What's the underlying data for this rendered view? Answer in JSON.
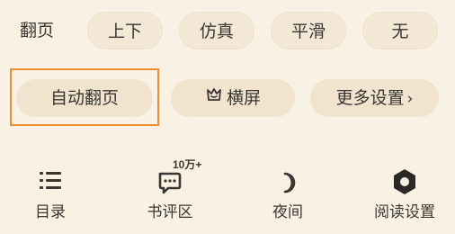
{
  "page_turn": {
    "label": "翻页",
    "options": [
      "上下",
      "仿真",
      "平滑",
      "无"
    ]
  },
  "actions": {
    "auto_page": "自动翻页",
    "landscape": "横屏",
    "more_settings": "更多设置",
    "more_chevron": "›"
  },
  "bottom_nav": {
    "catalog": "目录",
    "comments": "书评区",
    "comments_badge": "10万+",
    "night": "夜间",
    "reading_settings": "阅读设置"
  },
  "colors": {
    "background": "#f9f1e3",
    "pill": "#f3e8d6",
    "highlight": "#ee8e2e",
    "text": "#3a3631"
  },
  "icons": [
    "list-icon",
    "comment-icon",
    "moon-icon",
    "hexagon-icon",
    "crown-icon",
    "chevron-right-icon"
  ]
}
